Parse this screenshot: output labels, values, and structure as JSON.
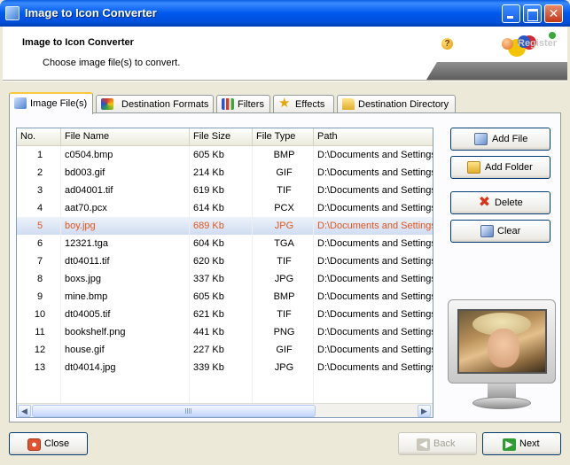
{
  "window": {
    "title": "Image to Icon Converter"
  },
  "header": {
    "title": "Image to Icon Converter",
    "subtitle": "Choose image file(s) to convert.",
    "help_label": "Help",
    "register_label": "Register"
  },
  "tabs": [
    {
      "label": "Image File(s)",
      "icon": "image-icon",
      "active": true
    },
    {
      "label": "Destination Formats",
      "icon": "formats-icon",
      "active": false
    },
    {
      "label": "Filters",
      "icon": "filters-icon",
      "active": false
    },
    {
      "label": "Effects",
      "icon": "star-icon",
      "active": false
    },
    {
      "label": "Destination Directory",
      "icon": "folder-icon",
      "active": false
    }
  ],
  "file_list": {
    "columns": [
      "No.",
      "File Name",
      "File Size",
      "File Type",
      "Path"
    ],
    "selected_index": 4,
    "rows": [
      {
        "no": "1",
        "name": "c0504.bmp",
        "size": "605 Kb",
        "type": "BMP",
        "path": "D:\\Documents and Settings"
      },
      {
        "no": "2",
        "name": "bd003.gif",
        "size": "214 Kb",
        "type": "GIF",
        "path": "D:\\Documents and Settings"
      },
      {
        "no": "3",
        "name": "ad04001.tif",
        "size": "619 Kb",
        "type": "TIF",
        "path": "D:\\Documents and Settings"
      },
      {
        "no": "4",
        "name": "aat70.pcx",
        "size": "614 Kb",
        "type": "PCX",
        "path": "D:\\Documents and Settings"
      },
      {
        "no": "5",
        "name": "boy.jpg",
        "size": "689 Kb",
        "type": "JPG",
        "path": "D:\\Documents and Settings"
      },
      {
        "no": "6",
        "name": "12321.tga",
        "size": "604 Kb",
        "type": "TGA",
        "path": "D:\\Documents and Settings"
      },
      {
        "no": "7",
        "name": "dt04011.tif",
        "size": "620 Kb",
        "type": "TIF",
        "path": "D:\\Documents and Settings"
      },
      {
        "no": "8",
        "name": "boxs.jpg",
        "size": "337 Kb",
        "type": "JPG",
        "path": "D:\\Documents and Settings"
      },
      {
        "no": "9",
        "name": "mine.bmp",
        "size": "605 Kb",
        "type": "BMP",
        "path": "D:\\Documents and Settings"
      },
      {
        "no": "10",
        "name": "dt04005.tif",
        "size": "621 Kb",
        "type": "TIF",
        "path": "D:\\Documents and Settings"
      },
      {
        "no": "11",
        "name": "bookshelf.png",
        "size": "441 Kb",
        "type": "PNG",
        "path": "D:\\Documents and Settings"
      },
      {
        "no": "12",
        "name": "house.gif",
        "size": "227 Kb",
        "type": "GIF",
        "path": "D:\\Documents and Settings"
      },
      {
        "no": "13",
        "name": "dt04014.jpg",
        "size": "339 Kb",
        "type": "JPG",
        "path": "D:\\Documents and Settings"
      }
    ]
  },
  "actions": {
    "add_file": "Add File",
    "add_folder": "Add Folder",
    "delete": "Delete",
    "clear": "Clear"
  },
  "footer": {
    "close": "Close",
    "back": "Back",
    "next": "Next"
  },
  "colors": {
    "titlebar": "#0058ee",
    "selected_row_text": "#e5561e",
    "tab_highlight": "#ffc83c"
  }
}
